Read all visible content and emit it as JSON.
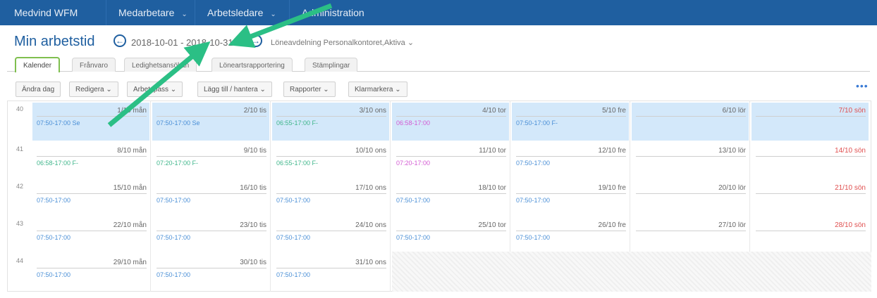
{
  "topnav": {
    "brand": "Medvind WFM",
    "items": [
      {
        "label": "Medarbetare",
        "caret": "⌄"
      },
      {
        "label": "Arbetsledare",
        "caret": "⌄"
      },
      {
        "label": "Administration",
        "caret": ""
      }
    ]
  },
  "header": {
    "title": "Min arbetstid",
    "prev_icon": "arrow-left-circle-icon",
    "date_range": "2018-10-01 - 2018-10-31",
    "next_icon": "arrow-right-circle-icon",
    "unit": "Löneavdelning Personalkontoret,Aktiva"
  },
  "tabs": [
    {
      "label": "Kalender",
      "active": true
    },
    {
      "label": "Frånvaro",
      "active": false
    },
    {
      "label": "Ledighetsansökan",
      "active": false
    },
    {
      "label": "Löneartsrapportering",
      "active": false
    },
    {
      "label": "Stämplingar",
      "active": false
    }
  ],
  "toolbar": [
    {
      "label": "Ändra dag"
    },
    {
      "label": "Redigera ⌄"
    },
    {
      "label": "Arbetspass ⌄"
    },
    {
      "label": "Lägg till / hantera ⌄"
    },
    {
      "label": "Rapporter ⌄"
    },
    {
      "label": "Klarmarkera ⌄"
    }
  ],
  "more_label": "•••",
  "calendar": {
    "weeks": [
      {
        "num": "40",
        "days": [
          {
            "date": "1/10 mån",
            "shift": "07:50-17:00 Se",
            "color": "blue",
            "hl": true
          },
          {
            "date": "2/10 tis",
            "shift": "07:50-17:00 Se",
            "color": "blue",
            "hl": true
          },
          {
            "date": "3/10 ons",
            "shift": "06:55-17:00 F-",
            "color": "green",
            "hl": true
          },
          {
            "date": "4/10 tor",
            "shift": "06:58-17:00",
            "color": "pink",
            "hl": true
          },
          {
            "date": "5/10 fre",
            "shift": "07:50-17:00 F-",
            "color": "blue",
            "hl": true
          },
          {
            "date": "6/10 lör",
            "shift": "",
            "color": "blue",
            "hl": true
          },
          {
            "date": "7/10 sön",
            "shift": "",
            "color": "blue",
            "hl": true,
            "red": true
          }
        ]
      },
      {
        "num": "41",
        "days": [
          {
            "date": "8/10 mån",
            "shift": "06:58-17:00 F-",
            "color": "green"
          },
          {
            "date": "9/10 tis",
            "shift": "07:20-17:00 F-",
            "color": "green"
          },
          {
            "date": "10/10 ons",
            "shift": "06:55-17:00 F-",
            "color": "green"
          },
          {
            "date": "11/10 tor",
            "shift": "07:20-17:00",
            "color": "pink"
          },
          {
            "date": "12/10 fre",
            "shift": "07:50-17:00",
            "color": "blue"
          },
          {
            "date": "13/10 lör",
            "shift": "",
            "color": "blue"
          },
          {
            "date": "14/10 sön",
            "shift": "",
            "color": "blue",
            "red": true
          }
        ]
      },
      {
        "num": "42",
        "days": [
          {
            "date": "15/10 mån",
            "shift": "07:50-17:00",
            "color": "blue"
          },
          {
            "date": "16/10 tis",
            "shift": "07:50-17:00",
            "color": "blue"
          },
          {
            "date": "17/10 ons",
            "shift": "07:50-17:00",
            "color": "blue"
          },
          {
            "date": "18/10 tor",
            "shift": "07:50-17:00",
            "color": "blue"
          },
          {
            "date": "19/10 fre",
            "shift": "07:50-17:00",
            "color": "blue"
          },
          {
            "date": "20/10 lör",
            "shift": "",
            "color": "blue"
          },
          {
            "date": "21/10 sön",
            "shift": "",
            "color": "blue",
            "red": true
          }
        ]
      },
      {
        "num": "43",
        "days": [
          {
            "date": "22/10 mån",
            "shift": "07:50-17:00",
            "color": "blue"
          },
          {
            "date": "23/10 tis",
            "shift": "07:50-17:00",
            "color": "blue"
          },
          {
            "date": "24/10 ons",
            "shift": "07:50-17:00",
            "color": "blue"
          },
          {
            "date": "25/10 tor",
            "shift": "07:50-17:00",
            "color": "blue"
          },
          {
            "date": "26/10 fre",
            "shift": "07:50-17:00",
            "color": "blue"
          },
          {
            "date": "27/10 lör",
            "shift": "",
            "color": "blue"
          },
          {
            "date": "28/10 sön",
            "shift": "",
            "color": "blue",
            "red": true
          }
        ]
      },
      {
        "num": "44",
        "days": [
          {
            "date": "29/10 mån",
            "shift": "07:50-17:00",
            "color": "blue"
          },
          {
            "date": "30/10 tis",
            "shift": "07:50-17:00",
            "color": "blue"
          },
          {
            "date": "31/10 ons",
            "shift": "07:50-17:00",
            "color": "blue"
          }
        ]
      }
    ]
  },
  "colors": {
    "topbar": "#1f5fa0",
    "highlight_week": "#d3e8fa",
    "active_tab_border": "#7fbf4f",
    "shift_blue": "#4a8fd6",
    "shift_green": "#3fb68b",
    "shift_pink": "#d35ad3",
    "sunday_red": "#e05050",
    "annotation_arrow": "#2bbf85"
  }
}
